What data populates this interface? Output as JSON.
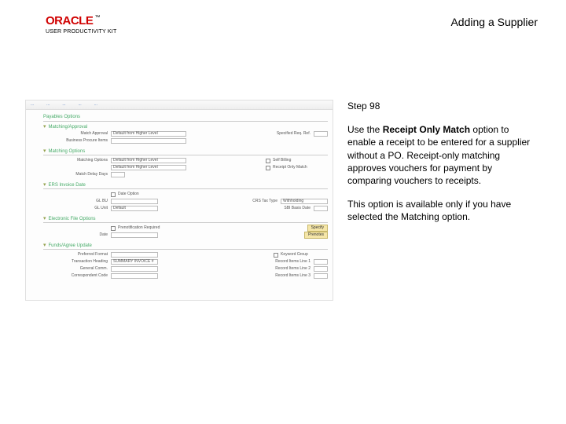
{
  "header": {
    "logo_text": "ORACLE",
    "logo_tm": "™",
    "logo_sub": "USER PRODUCTIVITY KIT",
    "page_title": "Adding a Supplier"
  },
  "sidebar": {
    "step_label": "Step 98",
    "para1_pre": "Use the ",
    "para1_bold": "Receipt Only Match",
    "para1_post": " option to enable a receipt to be entered for a supplier without a PO. Receipt-only matching approves vouchers for payment by comparing vouchers to receipts.",
    "para2": "This option is available only if you have selected the Matching option."
  },
  "shot": {
    "tabs": [
      "...",
      "...",
      "...",
      "...",
      "...",
      "..."
    ],
    "section1_title": "Payables Options",
    "section2_title": "Matching/Approval",
    "section3_title": "Matching Options",
    "section4_title": "ERS Invoice Date",
    "section5_title": "Electronic File Options",
    "section6_title": "Funds/Agree Update",
    "labels": {
      "match_approval": "Match Approval",
      "business_proc": "Business Procure Items",
      "matching_options": "Matching Options",
      "match_delay_days": "Match Delay Days",
      "spec_req": "Specified Req. Ref.",
      "self_billing": "Self Billing",
      "receipt_only": "Receipt Only Match",
      "date_opts_a": "Date Option",
      "gl81": "GL BU",
      "gl81b": "GL Unit",
      "prenote": "Prenotification Required",
      "date": "Date",
      "preferred_format": "Preferred Format",
      "trans_heading": "Transaction Heading",
      "general_comm": "General Comm.",
      "cust_acct": "Correspondent Code",
      "keyword_group": "Keyword Group",
      "rec_items1": "Record Items Line 1",
      "rec_items2": "Record Items Line 2",
      "rec_items3": "Record Items Line 3",
      "ct_src": "CRS Tax Type",
      "sbi_basis": "SBI Basis Date"
    },
    "values": {
      "match_approval": "Default from Higher Level",
      "matching_options": "Default from Higher Level",
      "matching_options2": "Default from Higher Level",
      "gl81b": "Default",
      "trans_heading": "SUMMARY INVOICE #",
      "ct_src": "Withholding"
    },
    "buttons": {
      "specify": "Specify",
      "prenotes": "Prenotes"
    }
  }
}
